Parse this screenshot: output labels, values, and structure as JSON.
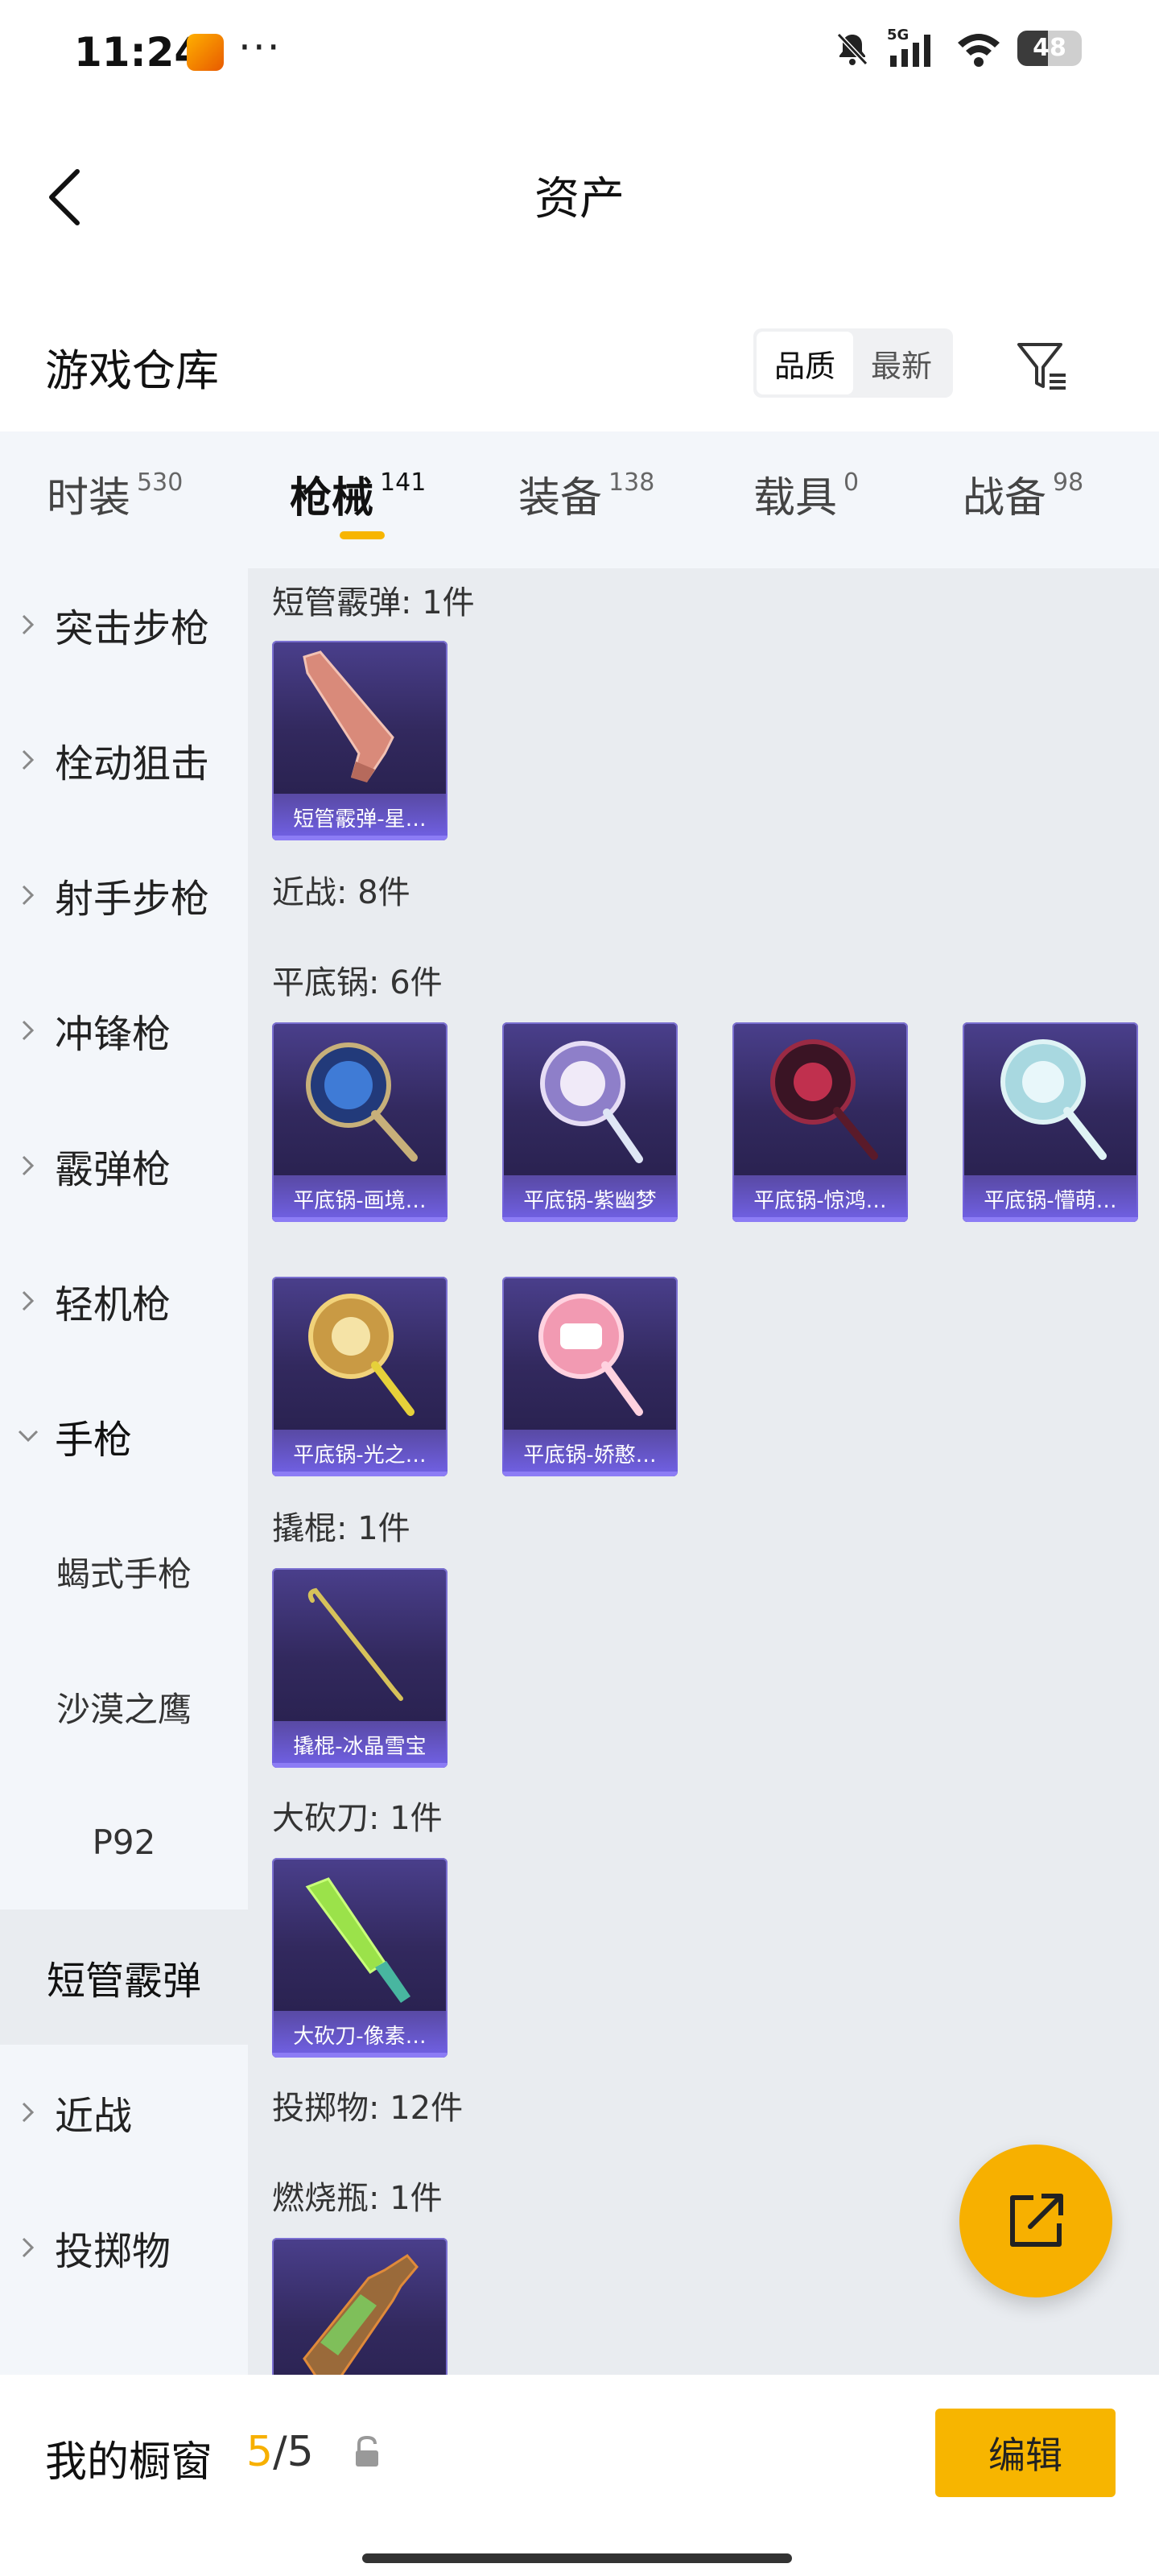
{
  "status_bar": {
    "time": "11:24",
    "dots": "···",
    "network": "5G",
    "battery": "48",
    "battery_level": 0.48
  },
  "nav": {
    "title": "资产"
  },
  "warehouse": {
    "title": "游戏仓库",
    "sort_options": [
      "品质",
      "最新"
    ],
    "sort_selected": "品质"
  },
  "tabs": [
    {
      "label": "时装",
      "count": "530"
    },
    {
      "label": "枪械",
      "count": "141",
      "active": true
    },
    {
      "label": "装备",
      "count": "138"
    },
    {
      "label": "载具",
      "count": "0"
    },
    {
      "label": "战备",
      "count": "98"
    }
  ],
  "sidebar": {
    "items": [
      {
        "label": "突击步枪"
      },
      {
        "label": "栓动狙击"
      },
      {
        "label": "射手步枪"
      },
      {
        "label": "冲锋枪"
      },
      {
        "label": "霰弹枪"
      },
      {
        "label": "轻机枪"
      },
      {
        "label": "手枪"
      },
      {
        "label": "蝎式手枪"
      },
      {
        "label": "沙漠之鹰"
      },
      {
        "label": "P92"
      },
      {
        "label": "短管霰弹"
      },
      {
        "label": "近战"
      },
      {
        "label": "投掷物"
      }
    ]
  },
  "content": {
    "sections": [
      {
        "label": "短管霰弹: 1件"
      },
      {
        "label": "近战: 8件"
      },
      {
        "label": "平底锅: 6件"
      },
      {
        "label": "撬棍: 1件"
      },
      {
        "label": "大砍刀: 1件"
      },
      {
        "label": "投掷物: 12件"
      },
      {
        "label": "燃烧瓶: 1件"
      }
    ],
    "cards": [
      {
        "name": "短管霰弹-星…"
      },
      {
        "name": "平底锅-画境…"
      },
      {
        "name": "平底锅-紫幽梦"
      },
      {
        "name": "平底锅-惊鸿…"
      },
      {
        "name": "平底锅-懵萌…"
      },
      {
        "name": "平底锅-光之…"
      },
      {
        "name": "平底锅-娇憨…"
      },
      {
        "name": "撬棍-冰晶雪宝"
      },
      {
        "name": "大砍刀-像素…"
      },
      {
        "name": ""
      }
    ]
  },
  "bottom_bar": {
    "label": "我的橱窗",
    "current": "5",
    "separator": "/",
    "total": "5",
    "edit_label": "编辑"
  },
  "colors": {
    "accent": "#f7b500",
    "card_bg": "#32295e",
    "card_bar": "#6f5fe0"
  }
}
